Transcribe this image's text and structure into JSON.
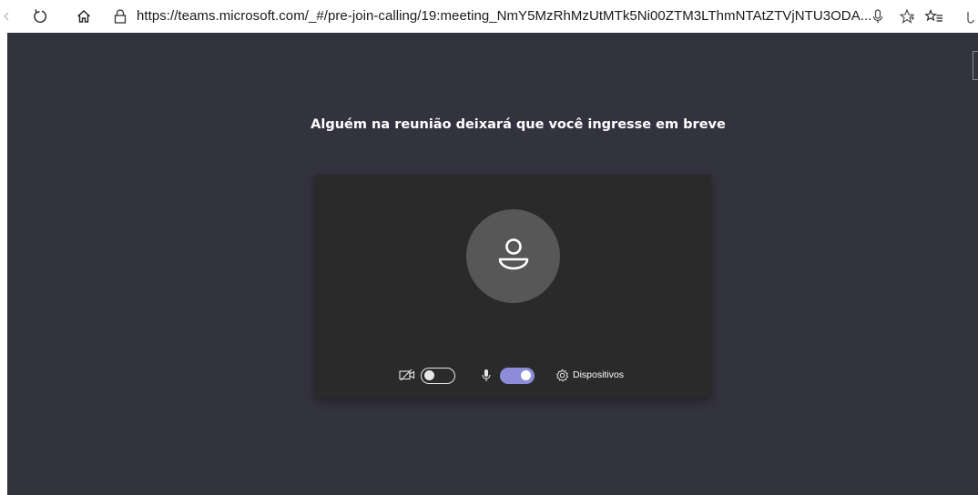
{
  "browser": {
    "url": "https://teams.microsoft.com/_#/pre-join-calling/19:meeting_NmY5MzRhMzUtMTk5Ni00ZTM3LThmNTAtZTVjNTU3ODA...",
    "icons": [
      "back-icon",
      "refresh-icon",
      "home-icon",
      "lock-icon",
      "microphone-icon",
      "favorite-star-icon",
      "favorites-list-icon",
      "collections-icon"
    ]
  },
  "prejoin": {
    "title": "Alguém na reunião deixará que você ingresse em breve",
    "camera_enabled": false,
    "microphone_enabled": true,
    "devices_label": "Dispositivos"
  },
  "colors": {
    "background": "#33323f",
    "card": "#2a2a2a",
    "avatar": "#575757",
    "toggle_on": "#8c8cd9"
  }
}
